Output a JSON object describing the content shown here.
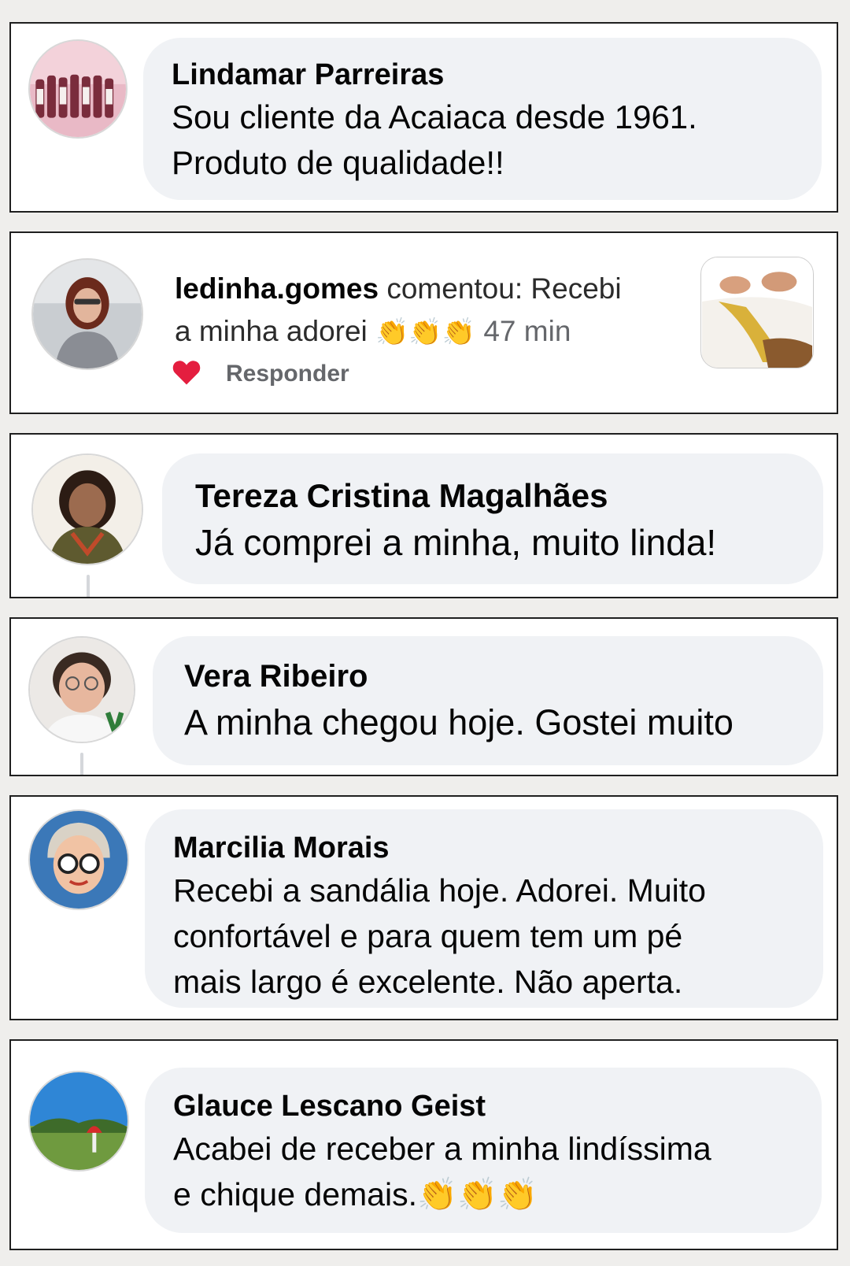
{
  "comments": [
    {
      "name": "Lindamar Parreiras",
      "text": "Sou cliente da Acaiaca  desde 1961.\nProduto de qualidade!!"
    },
    {
      "name": "Tereza Cristina Magalhães",
      "text": "Já comprei a minha, muito linda!"
    },
    {
      "name": "Vera Ribeiro",
      "text": "A minha chegou hoje. Gostei muito"
    },
    {
      "name": "Marcilia Morais",
      "text": "Recebi a sandália hoje. Adorei. Muito\nconfortável e para quem tem um pé\nmais largo é excelente. Não aperta."
    },
    {
      "name": "Glauce Lescano Geist",
      "text": "Acabei de receber a minha lindíssima\ne chique demais.👏👏👏"
    }
  ],
  "notification": {
    "username": "ledinha.gomes",
    "action": " comentou: Recebi",
    "line2": "a minha adorei ",
    "emojis": "👏👏👏",
    "time": " 47 min",
    "reply_label": "Responder"
  },
  "colors": {
    "bubble": "#f0f2f5",
    "heart": "#e41e3f",
    "muted": "#65676b"
  },
  "icons": {
    "like": "heart-icon"
  }
}
